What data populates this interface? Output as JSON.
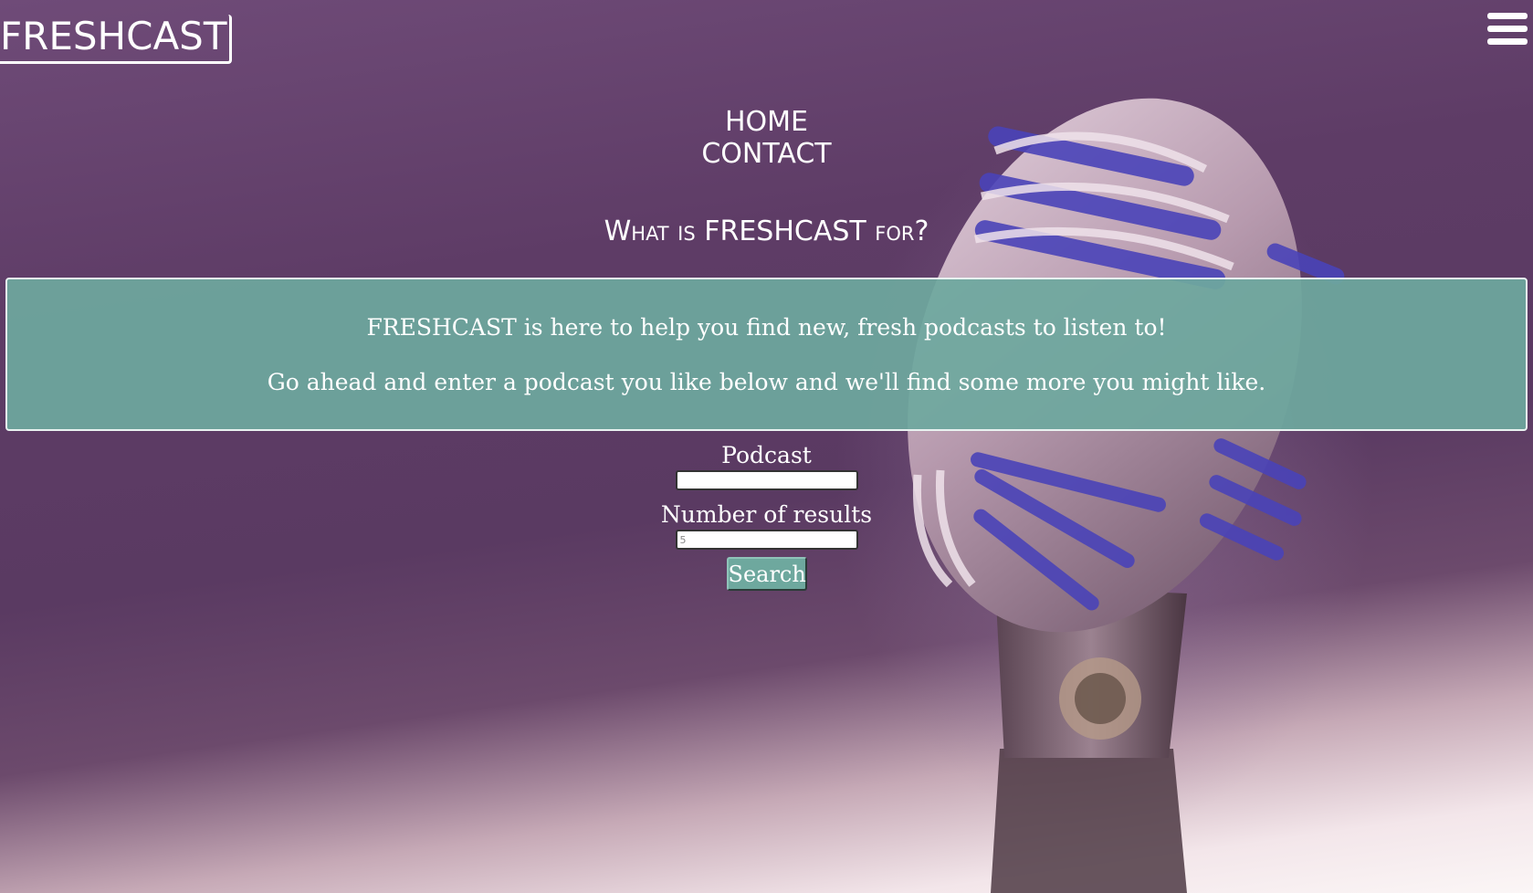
{
  "header": {
    "logo_text": "FRESHCAST",
    "menu_icon": "hamburger-menu-icon"
  },
  "nav": {
    "items": [
      {
        "label": "HOME"
      },
      {
        "label": "CONTACT"
      }
    ]
  },
  "main": {
    "heading": "What is FRESHCAST for?",
    "info": {
      "paragraph1": "FRESHCAST is here to help you find new, fresh podcasts to listen to!",
      "paragraph2": "Go ahead and enter a podcast you like below and we'll find some more you might like."
    },
    "form": {
      "podcast_label": "Podcast",
      "podcast_value": "",
      "results_label": "Number of results",
      "results_placeholder": "5",
      "search_label": "Search"
    }
  },
  "colors": {
    "accent_teal": "#6ea89e",
    "background_purple": "#5e3c66",
    "text": "#ffffff"
  }
}
